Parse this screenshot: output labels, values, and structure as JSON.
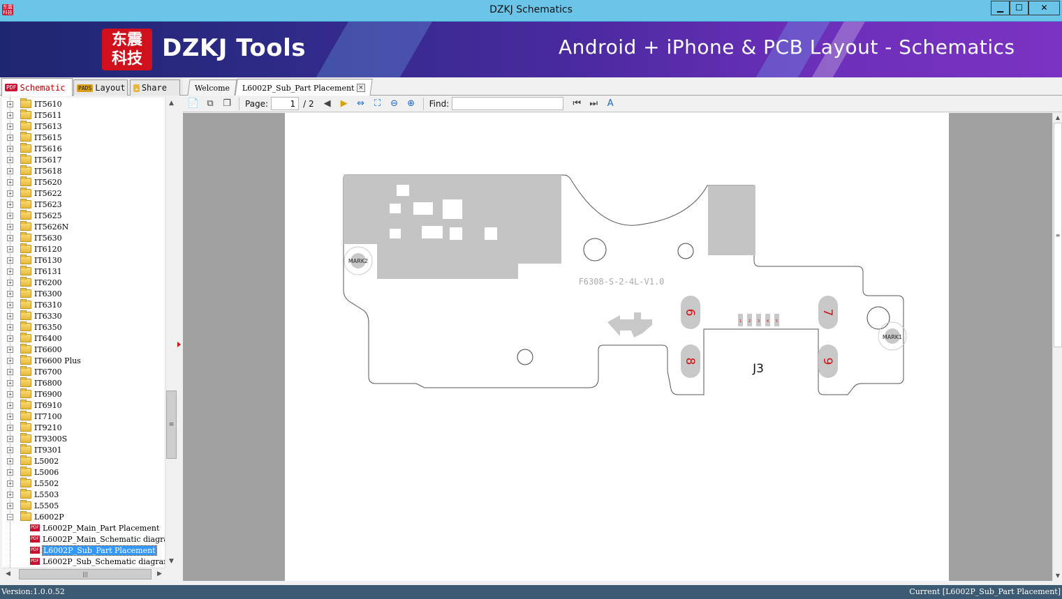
{
  "window": {
    "title": "DZKJ Schematics",
    "app_icon_text": "东震科技",
    "minimize": "▁",
    "maximize": "☐",
    "close": "✕"
  },
  "banner": {
    "logo_text": "东震\n科技",
    "brand": "DZKJ Tools",
    "tagline": "Android + iPhone & PCB Layout - Schematics"
  },
  "left_tabs": [
    {
      "icon": "PDF",
      "label": "Schematic",
      "active": true
    },
    {
      "icon": "PADS",
      "label": "Layout",
      "active": false
    },
    {
      "icon": "☁",
      "label": "Share",
      "active": false
    }
  ],
  "tree": {
    "folders": [
      "IT5610",
      "IT5611",
      "IT5613",
      "IT5615",
      "IT5616",
      "IT5617",
      "IT5618",
      "IT5620",
      "IT5622",
      "IT5623",
      "IT5625",
      "IT5626N",
      "IT5630",
      "IT6120",
      "IT6130",
      "IT6131",
      "IT6200",
      "IT6300",
      "IT6310",
      "IT6330",
      "IT6350",
      "IT6400",
      "IT6600",
      "IT6600 Plus",
      "IT6700",
      "IT6800",
      "IT6900",
      "IT6910",
      "IT7100",
      "IT9210",
      "IT9300S",
      "IT9301",
      "L5002",
      "L5006",
      "L5502",
      "L5503",
      "L5505"
    ],
    "open_folder": "L6002P",
    "files": [
      {
        "label": "L6002P_Main_Part Placement",
        "selected": false
      },
      {
        "label": "L6002P_Main_Schematic diagram",
        "selected": false
      },
      {
        "label": "L6002P_Sub_Part Placement",
        "selected": true
      },
      {
        "label": "L6002P_Sub_Schematic diagram",
        "selected": false
      }
    ],
    "pdf_icon_text": "PDF"
  },
  "doc_tabs": [
    {
      "label": "Welcome",
      "active": false
    },
    {
      "label": "L6002P_Sub_Part Placement",
      "active": true,
      "close": "×"
    }
  ],
  "toolbar": {
    "page_label": "Page:",
    "page_value": "1",
    "page_total": "/ 2",
    "find_label": "Find:",
    "find_value": ""
  },
  "board": {
    "label": "F6308-S-2-4L-V1.0",
    "connector": "J3",
    "mark1": "MARK1",
    "mark2": "MARK2",
    "pads": [
      "6",
      "7",
      "8",
      "9"
    ],
    "pins": [
      "1",
      "2",
      "3",
      "4",
      "5"
    ],
    "colors": {
      "pad": "#c8c8c8",
      "pad_text": "#d01010",
      "outline": "#555555",
      "fill": "#c4c4c4"
    }
  },
  "status": {
    "version": "Version:1.0.0.52",
    "current": "Current [L6002P_Sub_Part Placement]"
  }
}
